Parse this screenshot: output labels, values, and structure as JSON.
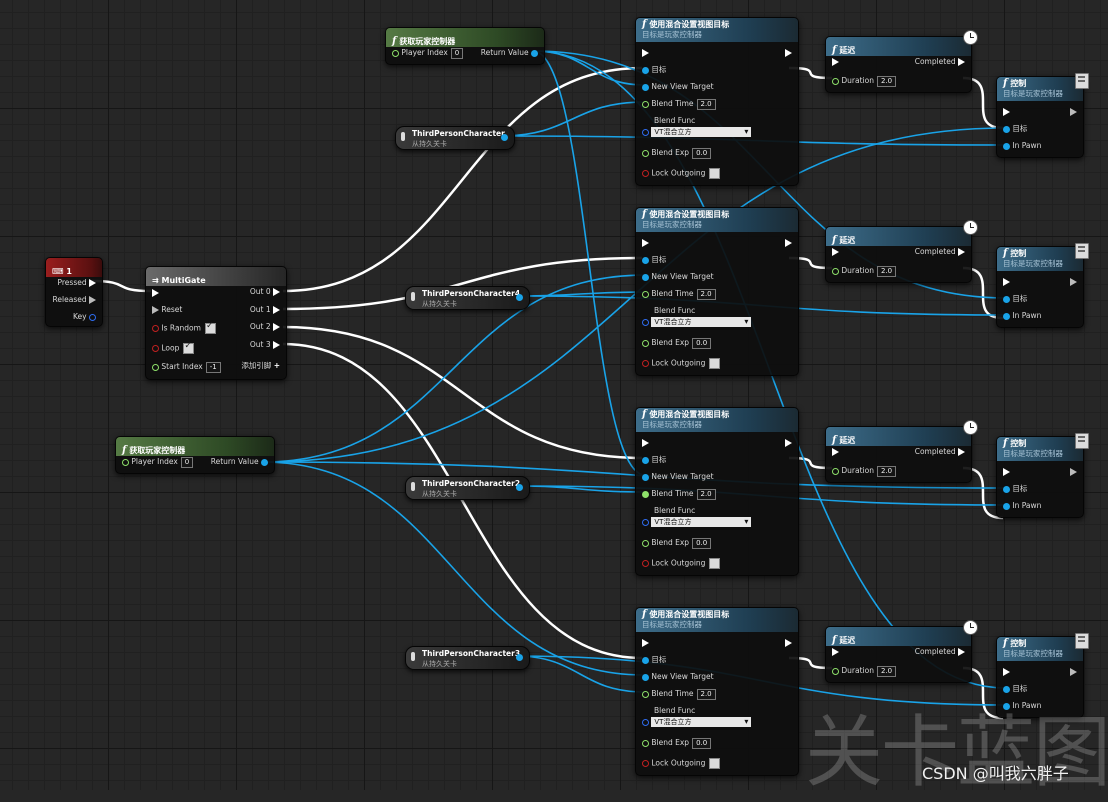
{
  "key_node": {
    "title": "1",
    "pins": [
      "Pressed",
      "Released",
      "Key"
    ]
  },
  "multigate": {
    "title": "MultiGate",
    "reset": "Reset",
    "is_random": "Is Random",
    "loop": "Loop",
    "start_index": "Start Index",
    "start_index_value": "-1",
    "add_pin": "添加引脚",
    "outs": [
      "Out 0",
      "Out 1",
      "Out 2",
      "Out 3"
    ]
  },
  "get_pc_nodes": [
    {
      "title": "获取玩家控制器",
      "player_index": "Player Index",
      "index_value": "0",
      "return": "Return Value"
    },
    {
      "title": "获取玩家控制器",
      "player_index": "Player Index",
      "index_value": "0",
      "return": "Return Value"
    }
  ],
  "char_vars": [
    {
      "title": "ThirdPersonCharacter",
      "subtitle": "从持久关卡"
    },
    {
      "title": "ThirdPersonCharacter4",
      "subtitle": "从持久关卡"
    },
    {
      "title": "ThirdPersonCharacter2",
      "subtitle": "从持久关卡"
    },
    {
      "title": "ThirdPersonCharacter3",
      "subtitle": "从持久关卡"
    }
  ],
  "blend_node": {
    "title": "使用混合设置视图目标",
    "subtitle": "目标是玩家控制器",
    "target": "目标",
    "new_view_target": "New View Target",
    "blend_time": "Blend Time",
    "blend_time_value": "2.0",
    "blend_func": "Blend Func",
    "blend_func_value": "VT混合立方",
    "blend_exp": "Blend Exp",
    "blend_exp_value": "0.0",
    "lock_outgoing": "Lock Outgoing"
  },
  "delay_node": {
    "title": "延迟",
    "completed": "Completed",
    "duration": "Duration",
    "duration_value": "2.0"
  },
  "possess_node": {
    "title": "控制",
    "subtitle": "目标是玩家控制器",
    "target": "目标",
    "in_pawn": "In Pawn"
  },
  "watermark": "关卡蓝图",
  "credit": "CSDN @叫我六胖子",
  "colors": {
    "exec": "#ffffff",
    "object": "#19a3e8",
    "float": "#8ee06a",
    "bool": "#c02020",
    "struct": "#2e6cf0"
  }
}
